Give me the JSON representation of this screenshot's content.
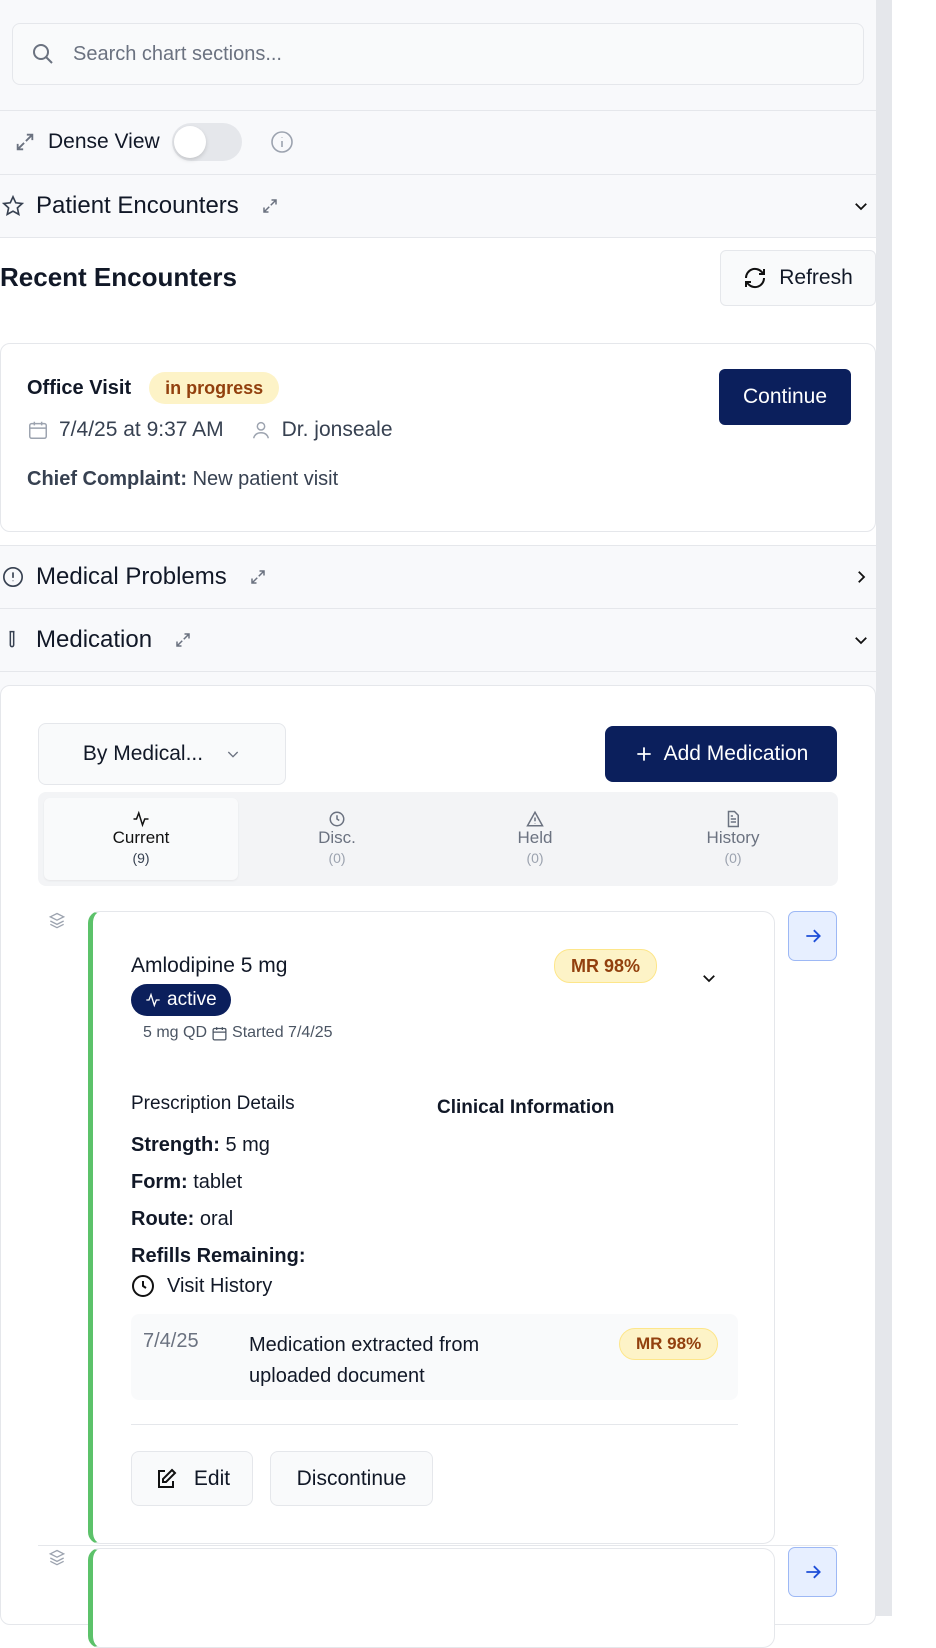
{
  "search": {
    "placeholder": "Search chart sections..."
  },
  "dense_view": {
    "label": "Dense View",
    "enabled": false
  },
  "sections": {
    "patient_encounters": "Patient Encounters",
    "medical_problems": "Medical Problems",
    "medication": "Medication"
  },
  "encounters": {
    "title": "Recent Encounters",
    "refresh": "Refresh",
    "item": {
      "type": "Office Visit",
      "status": "in progress",
      "datetime": "7/4/25 at 9:37 AM",
      "provider": "Dr. jonseale",
      "complaint_label": "Chief Complaint:",
      "complaint": "New patient visit",
      "continue": "Continue"
    }
  },
  "medication": {
    "group_by": "By Medical...",
    "add": "Add Medication",
    "tabs": [
      {
        "label": "Current",
        "count": "(9)"
      },
      {
        "label": "Disc.",
        "count": "(0)"
      },
      {
        "label": "Held",
        "count": "(0)"
      },
      {
        "label": "History",
        "count": "(0)"
      }
    ],
    "card": {
      "name": "Amlodipine 5 mg",
      "status": "active",
      "mr": "MR 98%",
      "dose": "5 mg QD",
      "started": "Started 7/4/25",
      "prescription_title": "Prescription Details",
      "clinical_title": "Clinical Information",
      "strength_label": "Strength:",
      "strength": "5 mg",
      "form_label": "Form:",
      "form": "tablet",
      "route_label": "Route:",
      "route": "oral",
      "refills_label": "Refills Remaining:",
      "visit_history": "Visit History",
      "history": {
        "date": "7/4/25",
        "text": "Medication extracted from uploaded document",
        "mr": "MR 98%"
      },
      "edit": "Edit",
      "discontinue": "Discontinue"
    }
  },
  "colors": {
    "primary": "#0b1f5c",
    "badge_bg": "#fdf3c7",
    "badge_text": "#92400e",
    "active_border": "#5cc26a"
  }
}
